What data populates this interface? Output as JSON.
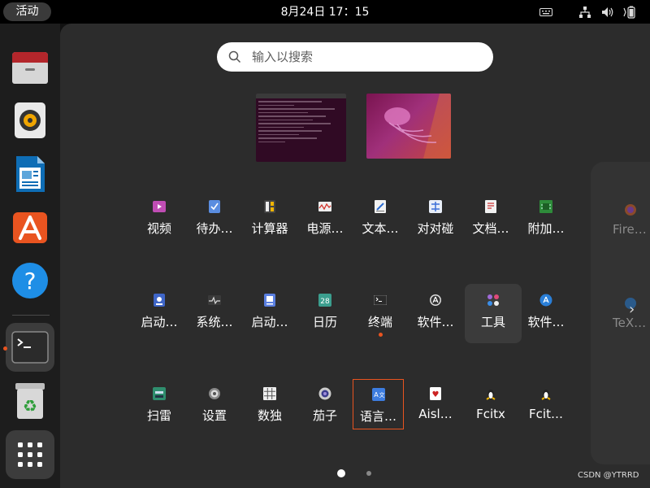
{
  "topbar": {
    "activities": "活动",
    "clock": "8月24日  17：15"
  },
  "dock": {
    "items": [
      {
        "name": "files",
        "icon": "file-cabinet-icon"
      },
      {
        "name": "rhythmbox",
        "icon": "speaker-icon"
      },
      {
        "name": "writer",
        "icon": "document-icon"
      },
      {
        "name": "software",
        "icon": "app-store-icon"
      },
      {
        "name": "help",
        "icon": "help-icon"
      },
      {
        "name": "terminal",
        "icon": "terminal-icon",
        "running": true
      },
      {
        "name": "trash",
        "icon": "trash-icon"
      },
      {
        "name": "show-apps",
        "icon": "app-grid-icon"
      }
    ]
  },
  "search": {
    "placeholder": "输入以搜索"
  },
  "apps": {
    "row1": [
      "视频",
      "待办…",
      "计算器",
      "电源…",
      "文本…",
      "对对碰",
      "文档…",
      "附加…"
    ],
    "row2": [
      "启动…",
      "系统…",
      "启动…",
      "日历",
      "终端",
      "软件…",
      "工具",
      "软件…"
    ],
    "row3": [
      "扫雷",
      "设置",
      "数独",
      "茄子",
      "语言…",
      "Aisl…",
      "Fcitx",
      "Fcit…"
    ]
  },
  "calendar_icon_text": "28",
  "next_page": {
    "items": [
      "Fire…",
      "TeX…"
    ]
  },
  "watermark": "CSDN @YTRRD",
  "colors": {
    "accent": "#e95420",
    "background": "#2c2c2c",
    "dock": "#1d1d1d"
  }
}
